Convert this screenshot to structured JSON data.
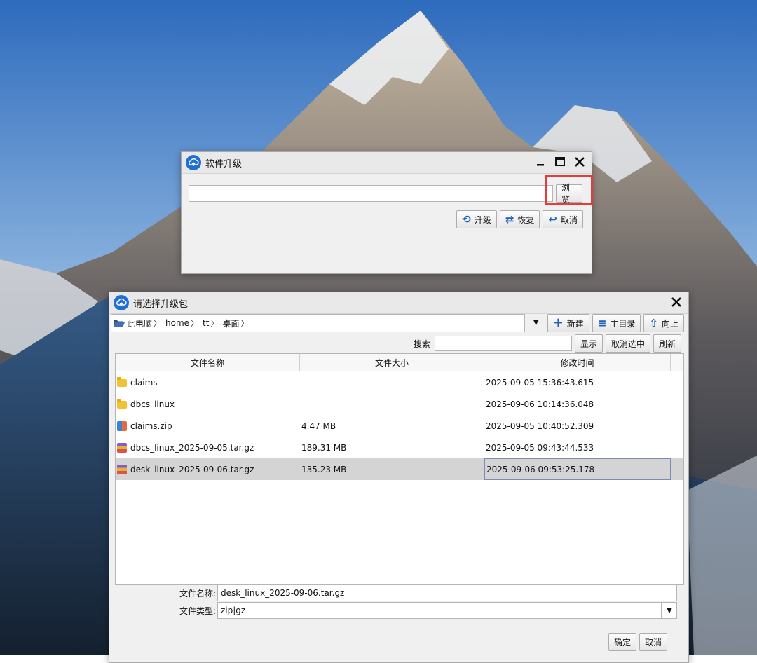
{
  "upgrade_window": {
    "title": "软件升级",
    "path_value": "",
    "browse_label": "浏览",
    "buttons": {
      "upgrade": "升级",
      "restore": "恢复",
      "cancel": "取消"
    }
  },
  "file_dialog": {
    "title": "请选择升级包",
    "breadcrumbs": [
      "此电脑",
      "home",
      "tt",
      "桌面"
    ],
    "toolbar": {
      "new": "新建",
      "home": "主目录",
      "up": "向上"
    },
    "search": {
      "label": "搜索",
      "value": "",
      "show": "显示",
      "deselect": "取消选中",
      "refresh": "刷新"
    },
    "columns": [
      "文件名称",
      "文件大小",
      "修改时间"
    ],
    "files": [
      {
        "name": "claims",
        "size": "",
        "modified": "2025-09-05 15:36:43.615",
        "icon": "folder-icon"
      },
      {
        "name": "dbcs_linux",
        "size": "",
        "modified": "2025-09-06 10:14:36.048",
        "icon": "folder-icon"
      },
      {
        "name": "claims.zip",
        "size": "4.47 MB",
        "modified": "2025-09-05 10:40:52.309",
        "icon": "zip-icon"
      },
      {
        "name": "dbcs_linux_2025-09-05.tar.gz",
        "size": "189.31 MB",
        "modified": "2025-09-05 09:43:44.533",
        "icon": "archive-icon"
      },
      {
        "name": "desk_linux_2025-09-06.tar.gz",
        "size": "135.23 MB",
        "modified": "2025-09-06 09:53:25.178",
        "icon": "archive-icon",
        "selected": true
      }
    ],
    "file_name_label": "文件名称:",
    "file_name_value": "desk_linux_2025-09-06.tar.gz",
    "file_type_label": "文件类型:",
    "file_type_value": "zip|gz",
    "ok": "确定",
    "cancel": "取消"
  },
  "colors": {
    "accent": "#1f6fd6",
    "highlight": "#e53b3b",
    "selected_row": "#d4d4d4"
  }
}
